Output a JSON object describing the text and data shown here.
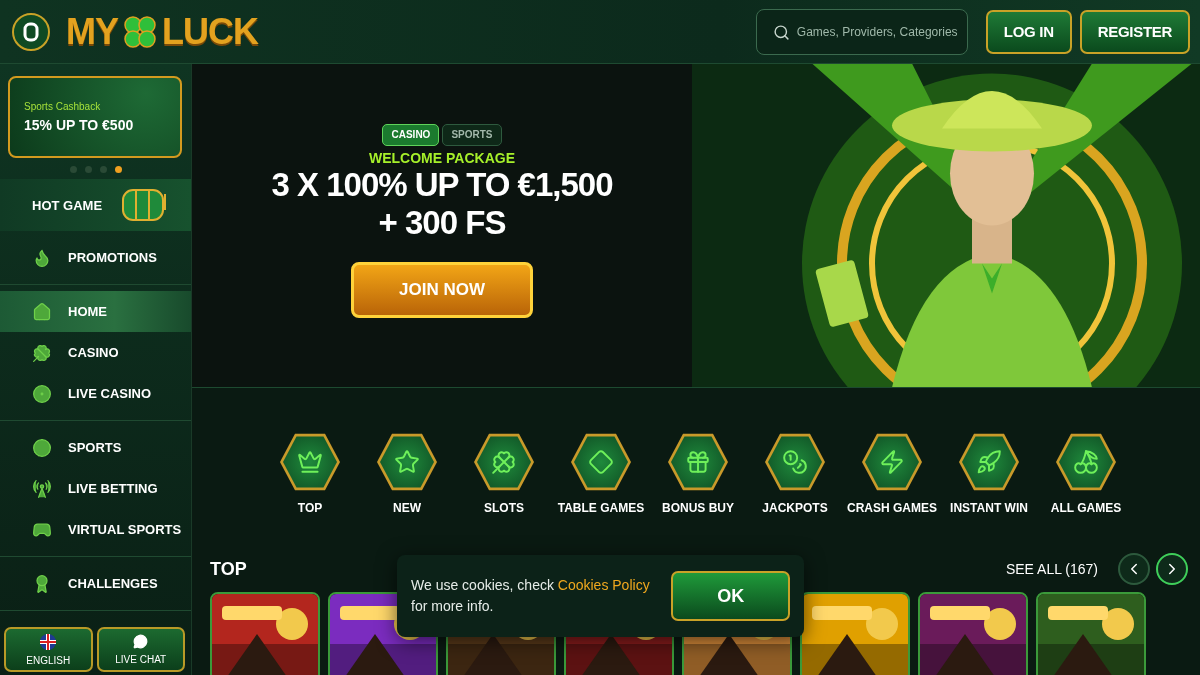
{
  "header": {
    "logo": {
      "left": "MY",
      "right": "LUCK"
    },
    "search": {
      "placeholder": "Games, Providers, Categories"
    },
    "buttons": [
      {
        "label": "LOG IN"
      },
      {
        "label": "REGISTER"
      }
    ]
  },
  "sidebar": {
    "promo": {
      "subtitle": "Sports Cashback",
      "title": "15% UP TO €500"
    },
    "dots": [
      {
        "selected": false
      },
      {
        "selected": false
      },
      {
        "selected": false
      },
      {
        "selected": true
      }
    ],
    "hot_game": {
      "label": "HOT GAME"
    },
    "groups": [
      [
        {
          "label": "PROMOTIONS",
          "selected": false
        }
      ],
      [
        {
          "label": "HOME",
          "selected": true
        },
        {
          "label": "CASINO",
          "selected": false
        },
        {
          "label": "LIVE CASINO",
          "selected": false
        }
      ],
      [
        {
          "label": "SPORTS",
          "selected": false
        },
        {
          "label": "LIVE BETTING",
          "selected": false
        },
        {
          "label": "VIRTUAL SPORTS",
          "selected": false
        }
      ],
      [
        {
          "label": "CHALLENGES",
          "selected": false
        }
      ]
    ],
    "footer_buttons": [
      {
        "label": "ENGLISH"
      },
      {
        "label": "LIVE CHAT"
      }
    ]
  },
  "hero": {
    "tabs": [
      {
        "label": "CASINO",
        "selected": true
      },
      {
        "label": "SPORTS",
        "selected": false
      }
    ],
    "kicker": "WELCOME PACKAGE",
    "headline": [
      "3 X 100% UP TO €1,500",
      "+ 300 FS"
    ],
    "cta": "JOIN NOW",
    "image": {
      "kind": "picture"
    }
  },
  "categories": [
    {
      "label": "TOP"
    },
    {
      "label": "NEW"
    },
    {
      "label": "SLOTS"
    },
    {
      "label": "TABLE GAMES"
    },
    {
      "label": "BONUS BUY"
    },
    {
      "label": "JACKPOTS"
    },
    {
      "label": "CRASH GAMES"
    },
    {
      "label": "INSTANT WIN"
    },
    {
      "label": "ALL GAMES"
    }
  ],
  "top_section": {
    "title": "TOP",
    "see_all": "SEE ALL (167)",
    "games": [
      {
        "kind": "picture"
      },
      {
        "kind": "picture"
      },
      {
        "kind": "picture"
      },
      {
        "kind": "picture"
      },
      {
        "kind": "picture"
      },
      {
        "kind": "picture"
      },
      {
        "kind": "picture"
      },
      {
        "kind": "picture"
      }
    ]
  },
  "cookie_notice": {
    "text_before": "We use cookies, check ",
    "link": "Cookies Policy",
    "text_after": " for more info.",
    "button": "OK"
  }
}
